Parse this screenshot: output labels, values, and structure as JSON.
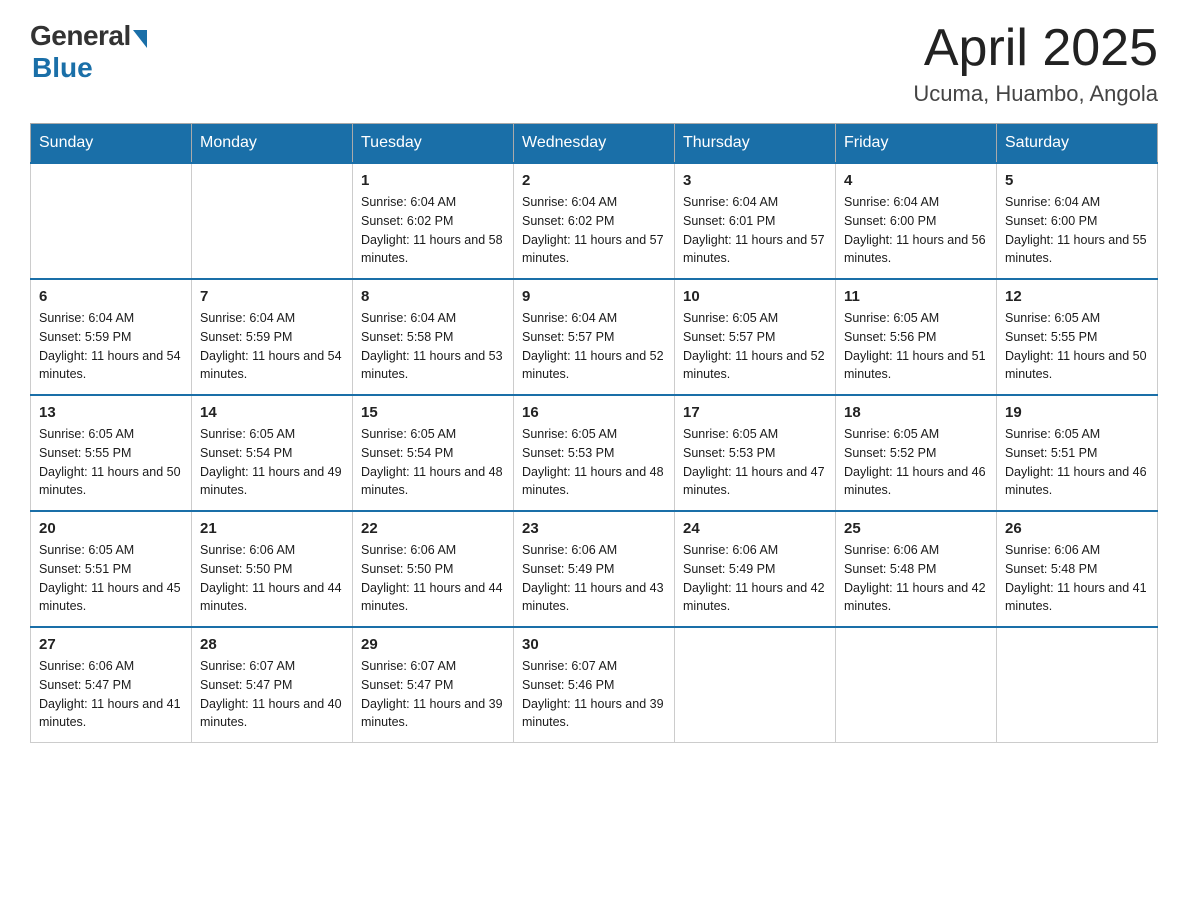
{
  "header": {
    "logo_general": "General",
    "logo_blue": "Blue",
    "month_title": "April 2025",
    "location": "Ucuma, Huambo, Angola"
  },
  "days_of_week": [
    "Sunday",
    "Monday",
    "Tuesday",
    "Wednesday",
    "Thursday",
    "Friday",
    "Saturday"
  ],
  "weeks": [
    [
      {
        "day": "",
        "sunrise": "",
        "sunset": "",
        "daylight": ""
      },
      {
        "day": "",
        "sunrise": "",
        "sunset": "",
        "daylight": ""
      },
      {
        "day": "1",
        "sunrise": "Sunrise: 6:04 AM",
        "sunset": "Sunset: 6:02 PM",
        "daylight": "Daylight: 11 hours and 58 minutes."
      },
      {
        "day": "2",
        "sunrise": "Sunrise: 6:04 AM",
        "sunset": "Sunset: 6:02 PM",
        "daylight": "Daylight: 11 hours and 57 minutes."
      },
      {
        "day": "3",
        "sunrise": "Sunrise: 6:04 AM",
        "sunset": "Sunset: 6:01 PM",
        "daylight": "Daylight: 11 hours and 57 minutes."
      },
      {
        "day": "4",
        "sunrise": "Sunrise: 6:04 AM",
        "sunset": "Sunset: 6:00 PM",
        "daylight": "Daylight: 11 hours and 56 minutes."
      },
      {
        "day": "5",
        "sunrise": "Sunrise: 6:04 AM",
        "sunset": "Sunset: 6:00 PM",
        "daylight": "Daylight: 11 hours and 55 minutes."
      }
    ],
    [
      {
        "day": "6",
        "sunrise": "Sunrise: 6:04 AM",
        "sunset": "Sunset: 5:59 PM",
        "daylight": "Daylight: 11 hours and 54 minutes."
      },
      {
        "day": "7",
        "sunrise": "Sunrise: 6:04 AM",
        "sunset": "Sunset: 5:59 PM",
        "daylight": "Daylight: 11 hours and 54 minutes."
      },
      {
        "day": "8",
        "sunrise": "Sunrise: 6:04 AM",
        "sunset": "Sunset: 5:58 PM",
        "daylight": "Daylight: 11 hours and 53 minutes."
      },
      {
        "day": "9",
        "sunrise": "Sunrise: 6:04 AM",
        "sunset": "Sunset: 5:57 PM",
        "daylight": "Daylight: 11 hours and 52 minutes."
      },
      {
        "day": "10",
        "sunrise": "Sunrise: 6:05 AM",
        "sunset": "Sunset: 5:57 PM",
        "daylight": "Daylight: 11 hours and 52 minutes."
      },
      {
        "day": "11",
        "sunrise": "Sunrise: 6:05 AM",
        "sunset": "Sunset: 5:56 PM",
        "daylight": "Daylight: 11 hours and 51 minutes."
      },
      {
        "day": "12",
        "sunrise": "Sunrise: 6:05 AM",
        "sunset": "Sunset: 5:55 PM",
        "daylight": "Daylight: 11 hours and 50 minutes."
      }
    ],
    [
      {
        "day": "13",
        "sunrise": "Sunrise: 6:05 AM",
        "sunset": "Sunset: 5:55 PM",
        "daylight": "Daylight: 11 hours and 50 minutes."
      },
      {
        "day": "14",
        "sunrise": "Sunrise: 6:05 AM",
        "sunset": "Sunset: 5:54 PM",
        "daylight": "Daylight: 11 hours and 49 minutes."
      },
      {
        "day": "15",
        "sunrise": "Sunrise: 6:05 AM",
        "sunset": "Sunset: 5:54 PM",
        "daylight": "Daylight: 11 hours and 48 minutes."
      },
      {
        "day": "16",
        "sunrise": "Sunrise: 6:05 AM",
        "sunset": "Sunset: 5:53 PM",
        "daylight": "Daylight: 11 hours and 48 minutes."
      },
      {
        "day": "17",
        "sunrise": "Sunrise: 6:05 AM",
        "sunset": "Sunset: 5:53 PM",
        "daylight": "Daylight: 11 hours and 47 minutes."
      },
      {
        "day": "18",
        "sunrise": "Sunrise: 6:05 AM",
        "sunset": "Sunset: 5:52 PM",
        "daylight": "Daylight: 11 hours and 46 minutes."
      },
      {
        "day": "19",
        "sunrise": "Sunrise: 6:05 AM",
        "sunset": "Sunset: 5:51 PM",
        "daylight": "Daylight: 11 hours and 46 minutes."
      }
    ],
    [
      {
        "day": "20",
        "sunrise": "Sunrise: 6:05 AM",
        "sunset": "Sunset: 5:51 PM",
        "daylight": "Daylight: 11 hours and 45 minutes."
      },
      {
        "day": "21",
        "sunrise": "Sunrise: 6:06 AM",
        "sunset": "Sunset: 5:50 PM",
        "daylight": "Daylight: 11 hours and 44 minutes."
      },
      {
        "day": "22",
        "sunrise": "Sunrise: 6:06 AM",
        "sunset": "Sunset: 5:50 PM",
        "daylight": "Daylight: 11 hours and 44 minutes."
      },
      {
        "day": "23",
        "sunrise": "Sunrise: 6:06 AM",
        "sunset": "Sunset: 5:49 PM",
        "daylight": "Daylight: 11 hours and 43 minutes."
      },
      {
        "day": "24",
        "sunrise": "Sunrise: 6:06 AM",
        "sunset": "Sunset: 5:49 PM",
        "daylight": "Daylight: 11 hours and 42 minutes."
      },
      {
        "day": "25",
        "sunrise": "Sunrise: 6:06 AM",
        "sunset": "Sunset: 5:48 PM",
        "daylight": "Daylight: 11 hours and 42 minutes."
      },
      {
        "day": "26",
        "sunrise": "Sunrise: 6:06 AM",
        "sunset": "Sunset: 5:48 PM",
        "daylight": "Daylight: 11 hours and 41 minutes."
      }
    ],
    [
      {
        "day": "27",
        "sunrise": "Sunrise: 6:06 AM",
        "sunset": "Sunset: 5:47 PM",
        "daylight": "Daylight: 11 hours and 41 minutes."
      },
      {
        "day": "28",
        "sunrise": "Sunrise: 6:07 AM",
        "sunset": "Sunset: 5:47 PM",
        "daylight": "Daylight: 11 hours and 40 minutes."
      },
      {
        "day": "29",
        "sunrise": "Sunrise: 6:07 AM",
        "sunset": "Sunset: 5:47 PM",
        "daylight": "Daylight: 11 hours and 39 minutes."
      },
      {
        "day": "30",
        "sunrise": "Sunrise: 6:07 AM",
        "sunset": "Sunset: 5:46 PM",
        "daylight": "Daylight: 11 hours and 39 minutes."
      },
      {
        "day": "",
        "sunrise": "",
        "sunset": "",
        "daylight": ""
      },
      {
        "day": "",
        "sunrise": "",
        "sunset": "",
        "daylight": ""
      },
      {
        "day": "",
        "sunrise": "",
        "sunset": "",
        "daylight": ""
      }
    ]
  ]
}
